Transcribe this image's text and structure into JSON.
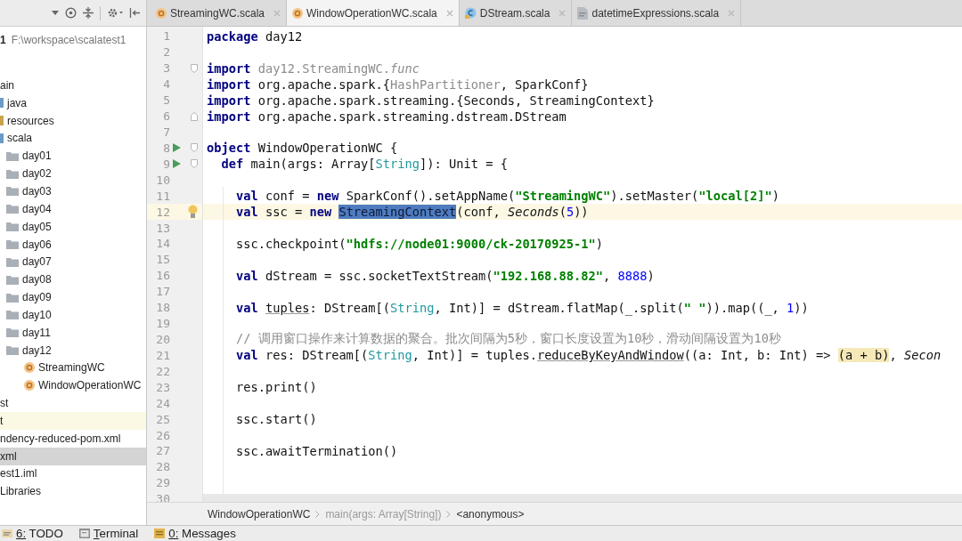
{
  "project_panel": {
    "project": {
      "name": "1",
      "path": "F:\\workspace\\scalatest1"
    },
    "tree": [
      {
        "label": "ain",
        "selected": false,
        "highlighted": false,
        "children": [
          {
            "label": "java",
            "kind": "source-folder",
            "selected": false
          },
          {
            "label": "resources",
            "kind": "resource-folder",
            "selected": false
          },
          {
            "label": "scala",
            "kind": "source-folder",
            "selected": false,
            "children": [
              {
                "label": "day01",
                "kind": "package",
                "selected": false
              },
              {
                "label": "day02",
                "kind": "package",
                "selected": false
              },
              {
                "label": "day03",
                "kind": "package",
                "selected": false
              },
              {
                "label": "day04",
                "kind": "package",
                "selected": false
              },
              {
                "label": "day05",
                "kind": "package",
                "selected": false
              },
              {
                "label": "day06",
                "kind": "package",
                "selected": false
              },
              {
                "label": "day07",
                "kind": "package",
                "selected": false
              },
              {
                "label": "day08",
                "kind": "package",
                "selected": false
              },
              {
                "label": "day09",
                "kind": "package",
                "selected": false
              },
              {
                "label": "day10",
                "kind": "package",
                "selected": false
              },
              {
                "label": "day11",
                "kind": "package",
                "selected": false
              },
              {
                "label": "day12",
                "kind": "package",
                "selected": false,
                "children": [
                  {
                    "label": "StreamingWC",
                    "kind": "object",
                    "selected": false
                  },
                  {
                    "label": "WindowOperationWC",
                    "kind": "object",
                    "selected": false
                  }
                ]
              }
            ]
          }
        ]
      },
      {
        "label": "st",
        "selected": false,
        "highlighted": false
      },
      {
        "label": "t",
        "selected": false,
        "highlighted": true
      },
      {
        "label": "ndency-reduced-pom.xml",
        "selected": false,
        "highlighted": false
      },
      {
        "label": "xml",
        "selected": true,
        "highlighted": false
      },
      {
        "label": "est1.iml",
        "selected": false,
        "highlighted": false
      },
      {
        "label": "Libraries",
        "selected": false,
        "highlighted": false
      }
    ]
  },
  "tabs": [
    {
      "label": "StreamingWC.scala",
      "kind": "object",
      "selected": false
    },
    {
      "label": "WindowOperationWC.scala",
      "kind": "object",
      "selected": true
    },
    {
      "label": "DStream.scala",
      "kind": "class",
      "selected": false
    },
    {
      "label": "datetimeExpressions.scala",
      "kind": "file",
      "selected": false
    }
  ],
  "editor": {
    "lines": [
      {
        "number": "1",
        "current": false,
        "tokens": [
          {
            "kind": "kw",
            "text": "package"
          },
          {
            "kind": "plain",
            "text": " day12"
          }
        ]
      },
      {
        "number": "2",
        "current": false
      },
      {
        "number": "3",
        "current": false,
        "markers": [
          {
            "kind": "fold-start"
          }
        ],
        "tokens": [
          {
            "kind": "kw",
            "text": "import"
          },
          {
            "kind": "dim",
            "text": " day12.StreamingWC."
          },
          {
            "kind": "dim-italic",
            "text": "func"
          }
        ]
      },
      {
        "number": "4",
        "current": false,
        "tokens": [
          {
            "kind": "kw",
            "text": "import"
          },
          {
            "kind": "plain",
            "text": " org.apache.spark.{"
          },
          {
            "kind": "dim",
            "text": "HashPartitioner"
          },
          {
            "kind": "plain",
            "text": ", SparkConf}"
          }
        ]
      },
      {
        "number": "5",
        "current": false,
        "tokens": [
          {
            "kind": "kw",
            "text": "import"
          },
          {
            "kind": "plain",
            "text": " org.apache.spark.streaming.{Seconds, StreamingContext}"
          }
        ]
      },
      {
        "number": "6",
        "current": false,
        "markers": [
          {
            "kind": "fold-end"
          }
        ],
        "tokens": [
          {
            "kind": "kw",
            "text": "import"
          },
          {
            "kind": "plain",
            "text": " org.apache.spark.streaming.dstream.DStream"
          }
        ]
      },
      {
        "number": "7",
        "current": false
      },
      {
        "number": "8",
        "current": false,
        "markers": [
          {
            "kind": "run"
          },
          {
            "kind": "fold-start"
          }
        ],
        "tokens": [
          {
            "kind": "kw",
            "text": "object"
          },
          {
            "kind": "plain",
            "text": " WindowOperationWC {"
          }
        ],
        "children": [
          {
            "number": "9",
            "current": false,
            "markers": [
              {
                "kind": "run"
              },
              {
                "kind": "fold-start"
              }
            ],
            "tokens": [
              {
                "kind": "kw",
                "text": "def"
              },
              {
                "kind": "plain",
                "text": " main(args: Array["
              },
              {
                "kind": "type",
                "text": "String"
              },
              {
                "kind": "plain",
                "text": "]): Unit = {"
              }
            ],
            "children": [
              {
                "number": "10",
                "current": false
              },
              {
                "number": "11",
                "current": false,
                "tokens": [
                  {
                    "kind": "kw",
                    "text": "val"
                  },
                  {
                    "kind": "plain",
                    "text": " conf = "
                  },
                  {
                    "kind": "kw",
                    "text": "new"
                  },
                  {
                    "kind": "plain",
                    "text": " SparkConf().setAppName("
                  },
                  {
                    "kind": "str",
                    "text": "\"StreamingWC\""
                  },
                  {
                    "kind": "plain",
                    "text": ").setMaster("
                  },
                  {
                    "kind": "str",
                    "text": "\"local[2]\""
                  },
                  {
                    "kind": "plain",
                    "text": ")"
                  }
                ]
              },
              {
                "number": "12",
                "current": true,
                "markers": [
                  {
                    "kind": "bulb"
                  }
                ],
                "tokens": [
                  {
                    "kind": "kw",
                    "text": "val"
                  },
                  {
                    "kind": "plain",
                    "text": " ssc = "
                  },
                  {
                    "kind": "kw",
                    "text": "new "
                  },
                  {
                    "kind": "selection",
                    "text": "StreamingContext"
                  },
                  {
                    "kind": "plain",
                    "text": "(conf, "
                  },
                  {
                    "kind": "italic",
                    "text": "Seconds"
                  },
                  {
                    "kind": "plain",
                    "text": "("
                  },
                  {
                    "kind": "num",
                    "text": "5"
                  },
                  {
                    "kind": "plain",
                    "text": "))"
                  }
                ]
              },
              {
                "number": "13",
                "current": false
              },
              {
                "number": "14",
                "current": false,
                "tokens": [
                  {
                    "kind": "plain",
                    "text": "ssc.checkpoint("
                  },
                  {
                    "kind": "str",
                    "text": "\"hdfs://node01:9000/ck-20170925-1\""
                  },
                  {
                    "kind": "plain",
                    "text": ")"
                  }
                ]
              },
              {
                "number": "15",
                "current": false
              },
              {
                "number": "16",
                "current": false,
                "tokens": [
                  {
                    "kind": "kw",
                    "text": "val"
                  },
                  {
                    "kind": "plain",
                    "text": " dStream = ssc.socketTextStream("
                  },
                  {
                    "kind": "str",
                    "text": "\"192.168.88.82\""
                  },
                  {
                    "kind": "plain",
                    "text": ", "
                  },
                  {
                    "kind": "num",
                    "text": "8888"
                  },
                  {
                    "kind": "plain",
                    "text": ")"
                  }
                ]
              },
              {
                "number": "17",
                "current": false
              },
              {
                "number": "18",
                "current": false,
                "tokens": [
                  {
                    "kind": "kw",
                    "text": "val "
                  },
                  {
                    "kind": "underlined",
                    "text": "tuples"
                  },
                  {
                    "kind": "plain",
                    "text": ": DStream[("
                  },
                  {
                    "kind": "type",
                    "text": "String"
                  },
                  {
                    "kind": "plain",
                    "text": ", Int)] = dStream.flatMap(_.split("
                  },
                  {
                    "kind": "str",
                    "text": "\" \""
                  },
                  {
                    "kind": "plain",
                    "text": ")).map((_, "
                  },
                  {
                    "kind": "num",
                    "text": "1"
                  },
                  {
                    "kind": "plain",
                    "text": "))"
                  }
                ]
              },
              {
                "number": "19",
                "current": false
              },
              {
                "number": "20",
                "current": false,
                "tokens": [
                  {
                    "kind": "comment",
                    "text": "// 调用窗口操作来计算数据的聚合。批次间隔为5秒，窗口长度设置为10秒，滑动间隔设置为10秒"
                  }
                ]
              },
              {
                "number": "21",
                "current": false,
                "tokens": [
                  {
                    "kind": "kw",
                    "text": "val"
                  },
                  {
                    "kind": "plain",
                    "text": " res: DStream[("
                  },
                  {
                    "kind": "type",
                    "text": "String"
                  },
                  {
                    "kind": "plain",
                    "text": ", Int)] = tuples."
                  },
                  {
                    "kind": "underlined",
                    "text": "reduceByKeyAndWindow"
                  },
                  {
                    "kind": "plain",
                    "text": "((a: Int, b: Int) => "
                  },
                  {
                    "kind": "match",
                    "text": "(a + b)"
                  },
                  {
                    "kind": "plain",
                    "text": ", "
                  },
                  {
                    "kind": "italic",
                    "text": "Secon"
                  }
                ]
              },
              {
                "number": "22",
                "current": false
              },
              {
                "number": "23",
                "current": false,
                "tokens": [
                  {
                    "kind": "plain",
                    "text": "res.print()"
                  }
                ]
              },
              {
                "number": "24",
                "current": false
              },
              {
                "number": "25",
                "current": false,
                "tokens": [
                  {
                    "kind": "plain",
                    "text": "ssc.start()"
                  }
                ]
              },
              {
                "number": "26",
                "current": false
              },
              {
                "number": "27",
                "current": false,
                "tokens": [
                  {
                    "kind": "plain",
                    "text": "ssc.awaitTermination()"
                  }
                ]
              },
              {
                "number": "28",
                "current": false
              },
              {
                "number": "29",
                "current": false
              },
              {
                "number": "30",
                "current": false
              }
            ]
          }
        ]
      }
    ]
  },
  "breadcrumbs": [
    "WindowOperationWC",
    "main(args: Array[String])",
    "<anonymous>"
  ],
  "tool_windows": [
    {
      "label": "6: TODO",
      "kind": "todo"
    },
    {
      "label": "Terminal",
      "kind": "terminal"
    },
    {
      "label": "0: Messages",
      "kind": "messages"
    }
  ]
}
